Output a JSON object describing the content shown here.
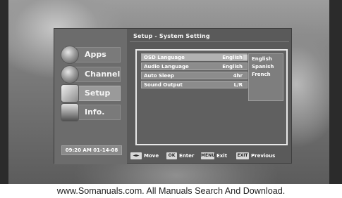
{
  "osd": {
    "title": "Setup - System Setting",
    "nav": [
      {
        "label": "Apps",
        "icon": "globe-icon"
      },
      {
        "label": "Channel",
        "icon": "channel-icon"
      },
      {
        "label": "Setup",
        "icon": "setup-icon"
      },
      {
        "label": "Info.",
        "icon": "info-icon"
      }
    ],
    "active_nav": "Setup",
    "clock": "09:20 AM 01-14-08",
    "settings": [
      {
        "label": "OSD Language",
        "value": "English"
      },
      {
        "label": "Audio Language",
        "value": "English"
      },
      {
        "label": "Auto Sleep",
        "value": "4hr"
      },
      {
        "label": "Sound Output",
        "value": "L/R"
      }
    ],
    "dropdown_options": [
      "English",
      "Spanish",
      "French"
    ],
    "hints": [
      {
        "key": "◄►",
        "text": "Move",
        "icon": "arrows-icon"
      },
      {
        "key": "OK",
        "text": "Enter"
      },
      {
        "key": "MENU",
        "text": "Exit"
      },
      {
        "key": "EXIT",
        "text": "Previous"
      }
    ]
  },
  "footer": {
    "watermark": "www.Somanuals.com. All Manuals Search And Download."
  }
}
